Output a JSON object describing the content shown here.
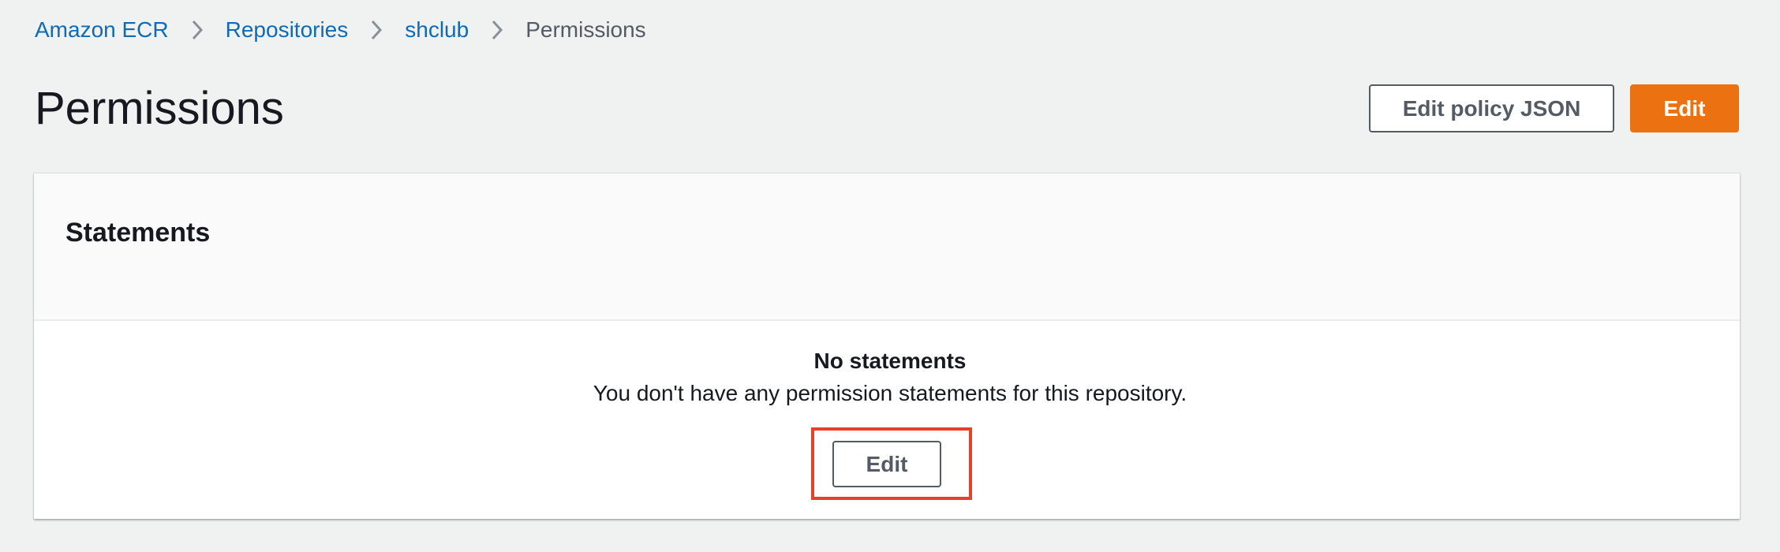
{
  "breadcrumb": {
    "items": [
      {
        "label": "Amazon ECR",
        "link": true
      },
      {
        "label": "Repositories",
        "link": true
      },
      {
        "label": "shclub",
        "link": true
      },
      {
        "label": "Permissions",
        "link": false
      }
    ],
    "separator_icon": "chevron-right-icon"
  },
  "header": {
    "title": "Permissions",
    "edit_policy_json_label": "Edit policy JSON",
    "edit_label": "Edit"
  },
  "statements": {
    "title": "Statements",
    "empty_heading": "No statements",
    "empty_description": "You don't have any permission statements for this repository.",
    "edit_label": "Edit"
  },
  "colors": {
    "link": "#0f6bb6",
    "primary": "#ec7211",
    "highlight": "#e8402a",
    "background": "#f0f1f1"
  }
}
